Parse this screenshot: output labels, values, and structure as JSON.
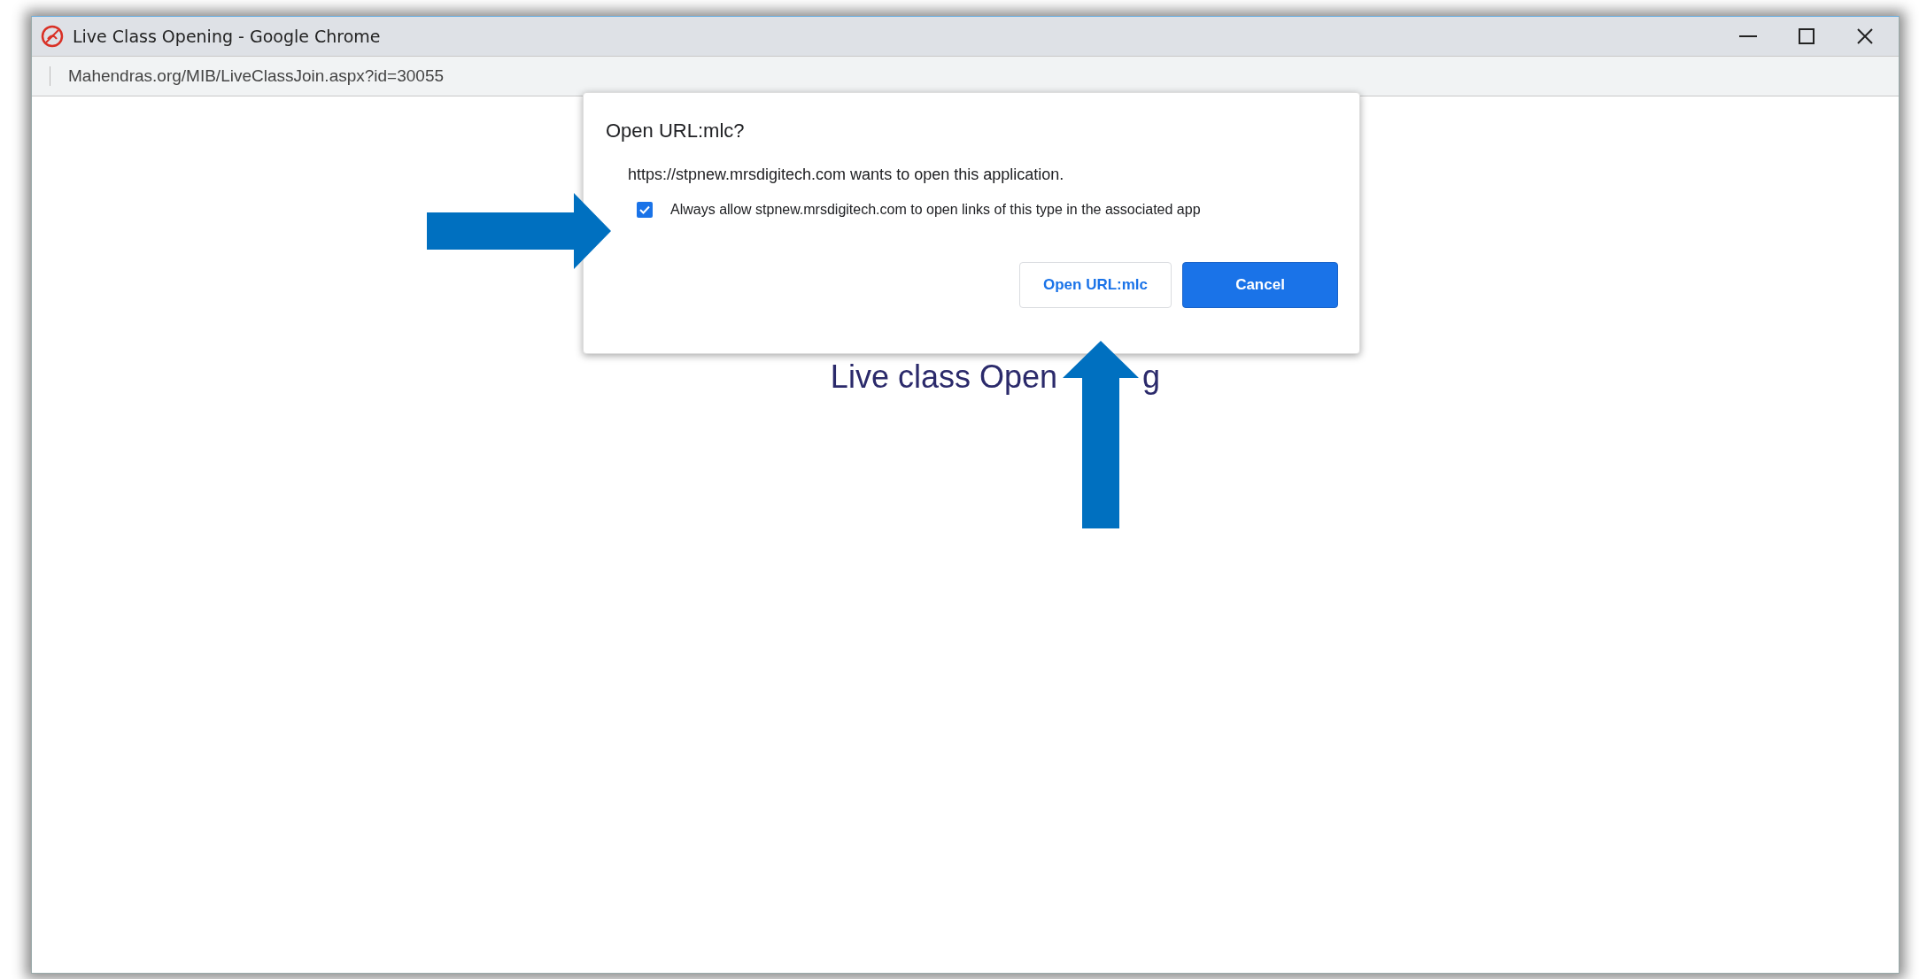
{
  "window": {
    "title": "Live Class Opening - Google Chrome",
    "address": "Mahendras.org/MIB/LiveClassJoin.aspx?id=30055"
  },
  "page": {
    "heading": "Live class Open",
    "heading_tail": "g"
  },
  "dialog": {
    "title": "Open URL:mlc?",
    "message": "https://stpnew.mrsdigitech.com wants to open this application.",
    "checkbox": {
      "label": "Always allow stpnew.mrsdigitech.com to open links of this type in the associated app",
      "checked": true
    },
    "buttons": [
      {
        "label": "Open URL:mlc",
        "kind": "secondary"
      },
      {
        "label": "Cancel",
        "kind": "primary"
      }
    ]
  }
}
